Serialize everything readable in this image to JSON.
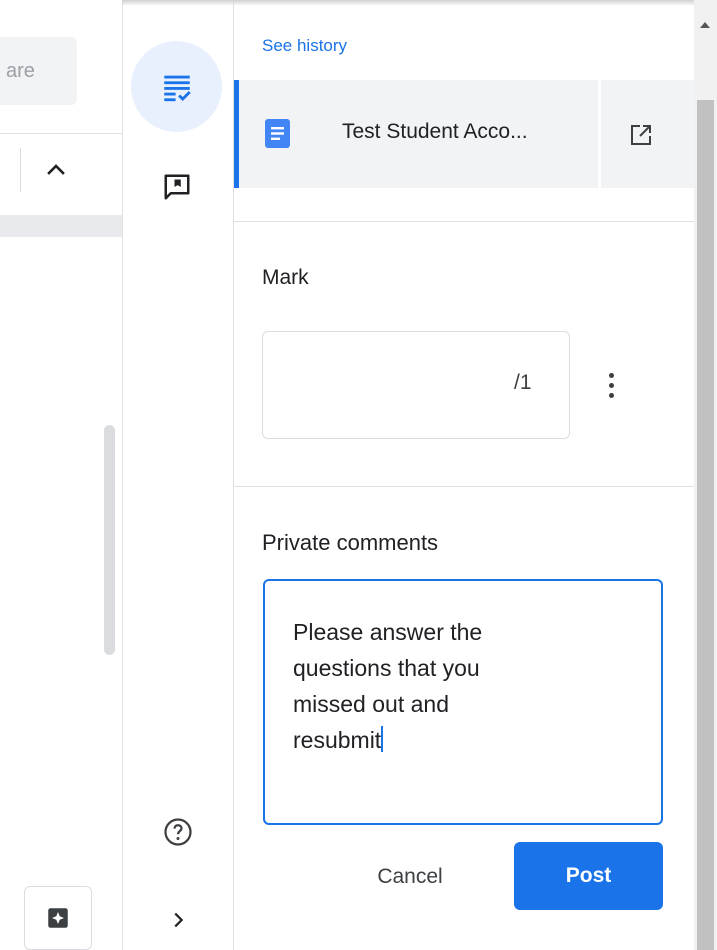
{
  "left_panel": {
    "share_chip_text": "are"
  },
  "side_panel": {
    "see_history_label": "See history",
    "file": {
      "name": "Test Student Acco..."
    },
    "mark": {
      "title": "Mark",
      "value": "",
      "denominator": "/1"
    },
    "private_comments": {
      "title": "Private comments",
      "text": "Please answer the\nquestions that you\nmissed out and\nresubmit"
    },
    "buttons": {
      "cancel_label": "Cancel",
      "post_label": "Post"
    }
  },
  "icons": {
    "rail_grade": "grading-list-icon",
    "rail_comments": "comment-bookmark-icon",
    "rail_help": "help-circle-icon",
    "rail_expand": "chevron-right-icon",
    "file": "google-doc-icon",
    "open_new": "open-in-new-icon",
    "more": "more-vert-icon",
    "collapse": "chevron-up-icon",
    "left_bottom": "keep-star-icon"
  },
  "colors": {
    "accent": "#1a73e8",
    "rail_active_bg": "#e8f0fe",
    "file_row_bg": "#f1f3f4"
  }
}
